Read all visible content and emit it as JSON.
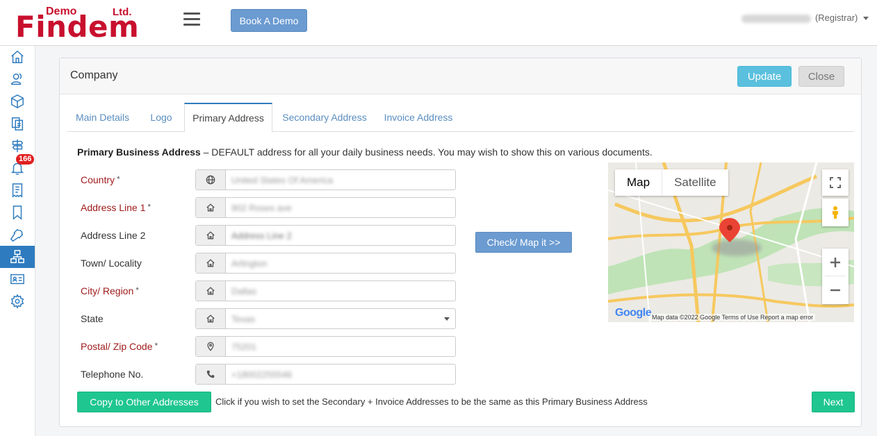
{
  "header": {
    "logo_demo": "Demo",
    "logo_ltd": "Ltd.",
    "logo_brand": "Findem",
    "book_demo_label": "Book A Demo",
    "user_role": "(Registrar)"
  },
  "sidebar": {
    "items": [
      {
        "icon": "home-icon"
      },
      {
        "icon": "users-icon"
      },
      {
        "icon": "box-icon"
      },
      {
        "icon": "documents-icon"
      },
      {
        "icon": "signpost-icon"
      },
      {
        "icon": "bell-icon",
        "badge": "166"
      },
      {
        "icon": "receipt-icon"
      },
      {
        "icon": "bookmark-icon"
      },
      {
        "icon": "wrench-icon"
      },
      {
        "icon": "hierarchy-icon",
        "active": true
      },
      {
        "icon": "id-card-icon"
      },
      {
        "icon": "gear-icon"
      }
    ],
    "accent": "#2e7bbf",
    "badge_color": "#e02020"
  },
  "card": {
    "title": "Company",
    "update_label": "Update",
    "close_label": "Close",
    "tabs": [
      {
        "label": "Main Details"
      },
      {
        "label": "Logo"
      },
      {
        "label": "Primary Address",
        "active": true
      },
      {
        "label": "Secondary Address"
      },
      {
        "label": "Invoice Address"
      }
    ],
    "intro_bold": "Primary Business Address",
    "intro_text": " – DEFAULT address for all your daily business needs. You may wish to show this on various documents.",
    "fields": [
      {
        "label": "Country",
        "required": true,
        "icon": "globe-icon",
        "value": "United States Of America",
        "placeholder": ""
      },
      {
        "label": "Address Line 1",
        "required": true,
        "icon": "home-icon",
        "value": "902 Roses ave",
        "placeholder": ""
      },
      {
        "label": "Address Line 2",
        "required": false,
        "icon": "home-icon",
        "value": "",
        "placeholder": "Address Line 2"
      },
      {
        "label": "Town/ Locality",
        "required": false,
        "icon": "home-icon",
        "value": "Arlington",
        "placeholder": ""
      },
      {
        "label": "City/ Region",
        "required": true,
        "icon": "home-icon",
        "value": "Dallas",
        "placeholder": ""
      },
      {
        "label": "State",
        "required": false,
        "icon": "home-icon",
        "value": "Texas",
        "placeholder": "",
        "select": true
      },
      {
        "label": "Postal/ Zip Code",
        "required": true,
        "icon": "map-pin-icon",
        "value": "75201",
        "placeholder": ""
      },
      {
        "label": "Telephone No.",
        "required": false,
        "icon": "phone-icon",
        "value": "+18002255546",
        "placeholder": ""
      }
    ],
    "required_mark": "*",
    "check_map_label": "Check/ Map it >>",
    "map": {
      "tab_map": "Map",
      "tab_satellite": "Satellite",
      "google": "Google",
      "footer": "Map data ©2022 Google    Terms of Use    Report a map error"
    },
    "copy_label": "Copy to Other Addresses",
    "copy_text": "Click if you wish to set the Secondary + Invoice Addresses to be the same as this Primary Business Address",
    "next_label": "Next"
  }
}
